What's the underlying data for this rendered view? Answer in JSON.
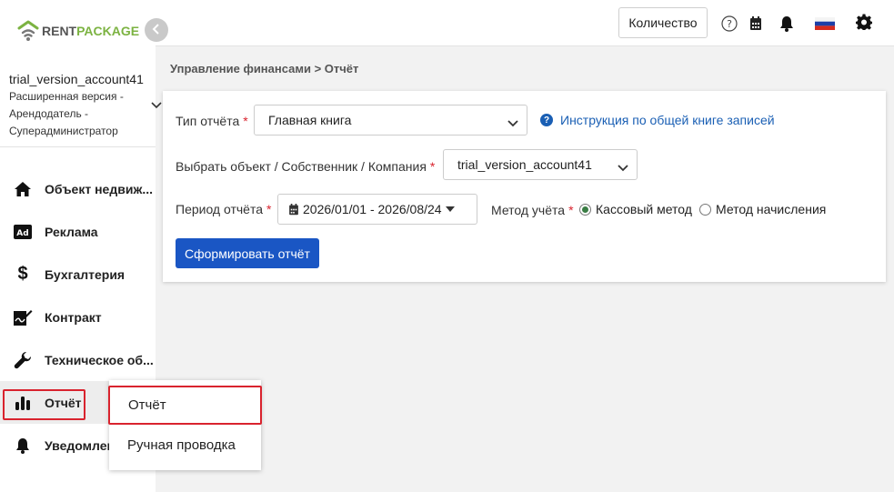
{
  "brand": {
    "rent": "RENT",
    "package": "PACKAGE"
  },
  "account": {
    "name": "trial_version_account41",
    "role": "Расширенная версия -\nАрендодатель -\nСуперадминистратор"
  },
  "sidebar": {
    "items": [
      {
        "label": "Объект недвиж...",
        "icon": "home-icon"
      },
      {
        "label": "Реклама",
        "icon": "ad-icon"
      },
      {
        "label": "Бухгалтерия",
        "icon": "dollar-icon"
      },
      {
        "label": "Контракт",
        "icon": "contract-icon"
      },
      {
        "label": "Техническое об...",
        "icon": "wrench-icon"
      },
      {
        "label": "Отчёт",
        "icon": "bar-chart-icon"
      },
      {
        "label": "Уведомлен",
        "icon": "bell-icon"
      }
    ]
  },
  "topbar": {
    "quantity_label": "Количество",
    "icons": [
      "help-icon",
      "calendar-icon",
      "bell-icon",
      "russia-flag-icon",
      "gear-icon"
    ]
  },
  "breadcrumb": "Управление финансами > Отчёт",
  "form": {
    "report_type_label": "Тип отчёта",
    "report_type_value": "Главная книга",
    "help_link": "Инструкция по общей книге записей",
    "object_label": "Выбрать объект / Собственник / Компания",
    "object_value": "trial_version_account41",
    "period_label": "Период отчёта",
    "period_value": "2026/01/01 - 2026/08/24",
    "method_label": "Метод учёта",
    "method_cash": "Кассовый метод",
    "method_accrual": "Метод начисления",
    "submit_label": "Сформировать отчёт",
    "required_mark": "*"
  },
  "submenu": {
    "items": [
      "Отчёт",
      "Ручная проводка"
    ]
  },
  "colors": {
    "accent": "#1a56c4",
    "brand_green": "#7cb342",
    "highlight_red": "#d9232e"
  }
}
